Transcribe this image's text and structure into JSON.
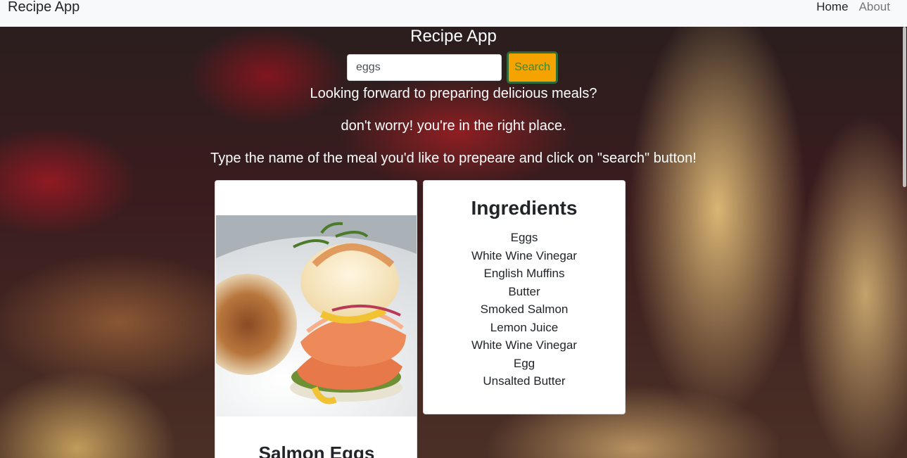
{
  "navbar": {
    "brand": "Recipe App",
    "links": [
      {
        "label": "Home",
        "active": true
      },
      {
        "label": "About",
        "active": false
      }
    ]
  },
  "hero": {
    "title": "Recipe App",
    "search": {
      "value": "eggs",
      "button_label": "Search"
    },
    "lines": [
      "Looking forward to preparing delicious meals?",
      "don't worry! you're in the right place.",
      "Type the name of the meal you'd like to prepeare and click on \"search\" button!"
    ]
  },
  "recipe": {
    "title": "Salmon Eggs",
    "image": "salmon-eggs-benedict-photo"
  },
  "ingredients": {
    "title": "Ingredients",
    "items": [
      "Eggs",
      "White Wine Vinegar",
      "English Muffins",
      "Butter",
      "Smoked Salmon",
      "Lemon Juice",
      "White Wine Vinegar",
      "Egg",
      "Unsalted Butter"
    ]
  },
  "colors": {
    "navbar_bg": "#f8f9fa",
    "search_button_bg": "#f4a300",
    "search_button_border": "#2f6a3a",
    "search_button_text": "#2e8b3a"
  }
}
